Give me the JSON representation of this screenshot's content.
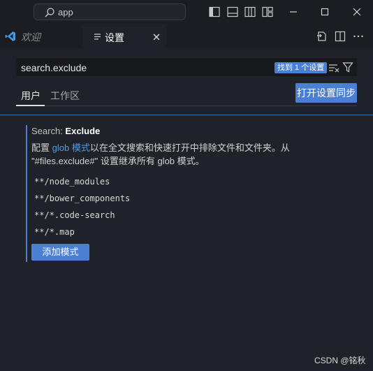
{
  "titlebar": {
    "command_center_text": "app"
  },
  "tabs": {
    "welcome_label": "欢迎",
    "settings_label": "设置"
  },
  "search": {
    "query": "search.exclude",
    "found_badge": "找到 1 个设置"
  },
  "scopes": {
    "user_label": "用户",
    "workspace_label": "工作区",
    "sync_button": "打开设置同步"
  },
  "setting": {
    "category": "Search: ",
    "key": "Exclude",
    "desc_prefix": "配置 ",
    "desc_link": "glob 模式",
    "desc_rest": "以在全文搜索和快速打开中排除文件和文件夹。从 \"#files.exclude#\" 设置继承所有 glob 模式。",
    "patterns": [
      "**/node_modules",
      "**/bower_components",
      "**/*.code-search",
      "**/*.map"
    ],
    "add_button": "添加模式"
  },
  "watermark": "CSDN @铭秋",
  "colors": {
    "accent": "#4a7fd4",
    "link": "#4d9ce8",
    "background": "#1f2228",
    "titlebar": "#1b1d22"
  }
}
